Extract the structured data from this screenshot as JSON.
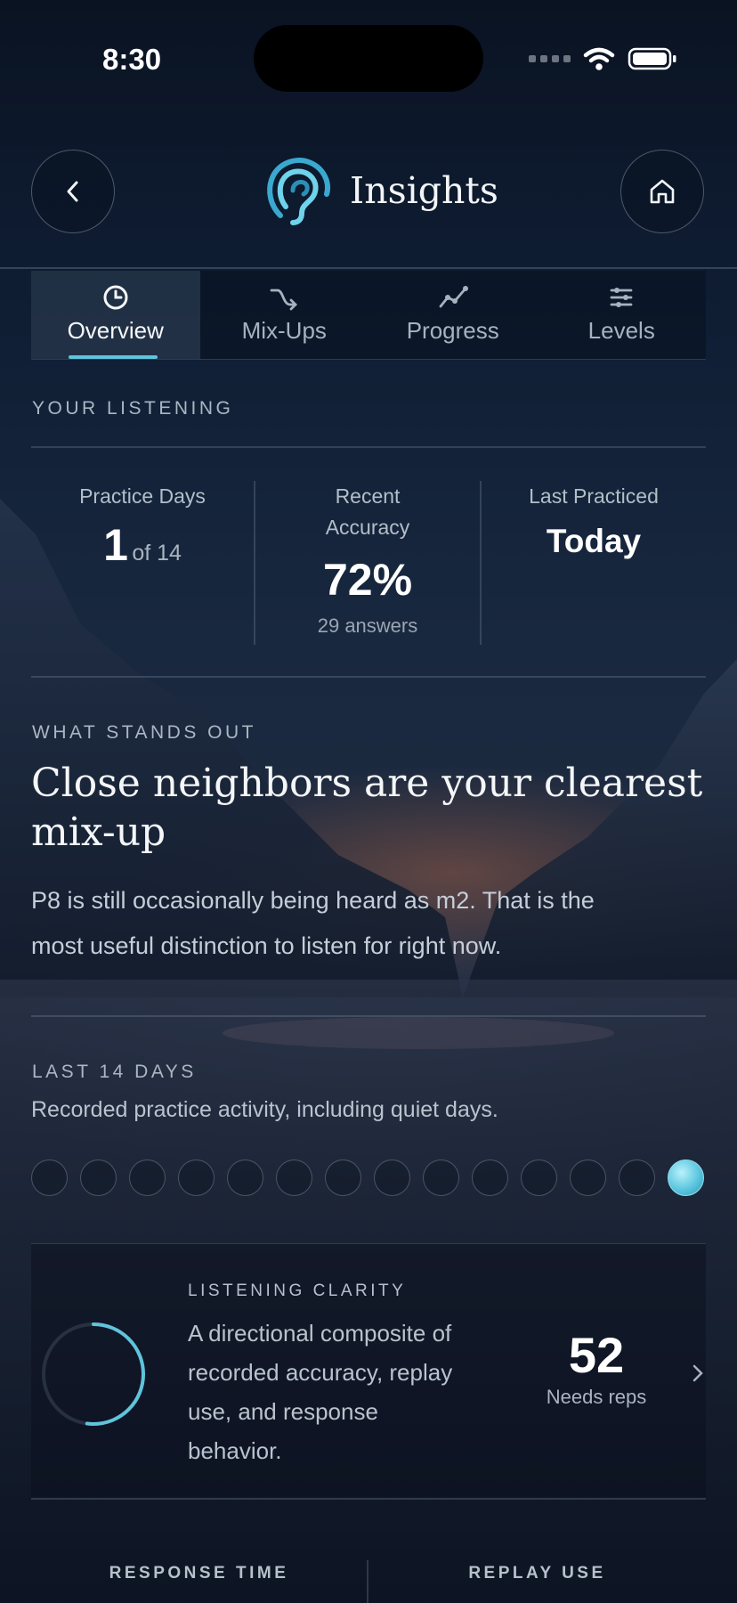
{
  "status_bar": {
    "time": "8:30"
  },
  "header": {
    "title": "Insights",
    "back_icon": "chevron-left-icon",
    "home_icon": "house-icon",
    "logo_icon": "ear-icon"
  },
  "tabs": [
    {
      "label": "Overview",
      "icon": "clock-pie-icon",
      "active": true
    },
    {
      "label": "Mix-Ups",
      "icon": "shuffle-icon",
      "active": false
    },
    {
      "label": "Progress",
      "icon": "trend-line-icon",
      "active": false
    },
    {
      "label": "Levels",
      "icon": "list-sliders-icon",
      "active": false
    }
  ],
  "listening": {
    "eyebrow": "YOUR LISTENING",
    "practice_days": {
      "label": "Practice Days",
      "value": "1",
      "suffix": "of 14"
    },
    "accuracy": {
      "label_line1": "Recent",
      "label_line2": "Accuracy",
      "value": "72%",
      "sub": "29 answers"
    },
    "last_practiced": {
      "label": "Last Practiced",
      "value": "Today"
    }
  },
  "stands_out": {
    "eyebrow": "WHAT STANDS OUT",
    "headline_line1": "Close neighbors are your clearest",
    "headline_line2": "mix-up",
    "body_line1": "P8 is still occasionally being heard as m2. That is the",
    "body_line2": "most useful distinction to listen for right now."
  },
  "last_14_days": {
    "eyebrow": "LAST 14 DAYS",
    "caption": "Recorded practice activity, including quiet days.",
    "days_active": [
      false,
      false,
      false,
      false,
      false,
      false,
      false,
      false,
      false,
      false,
      false,
      false,
      false,
      true
    ]
  },
  "clarity": {
    "eyebrow": "LISTENING CLARITY",
    "desc_line1": "A directional composite of",
    "desc_line2": "recorded accuracy, replay",
    "desc_line3": "use, and response",
    "desc_line4": "behavior.",
    "score": "52",
    "score_fraction": 0.52,
    "status": "Needs reps",
    "accent": "#5fc4dc"
  },
  "bottom_stats": {
    "response_time_label": "RESPONSE TIME",
    "replay_use_label": "REPLAY USE"
  }
}
